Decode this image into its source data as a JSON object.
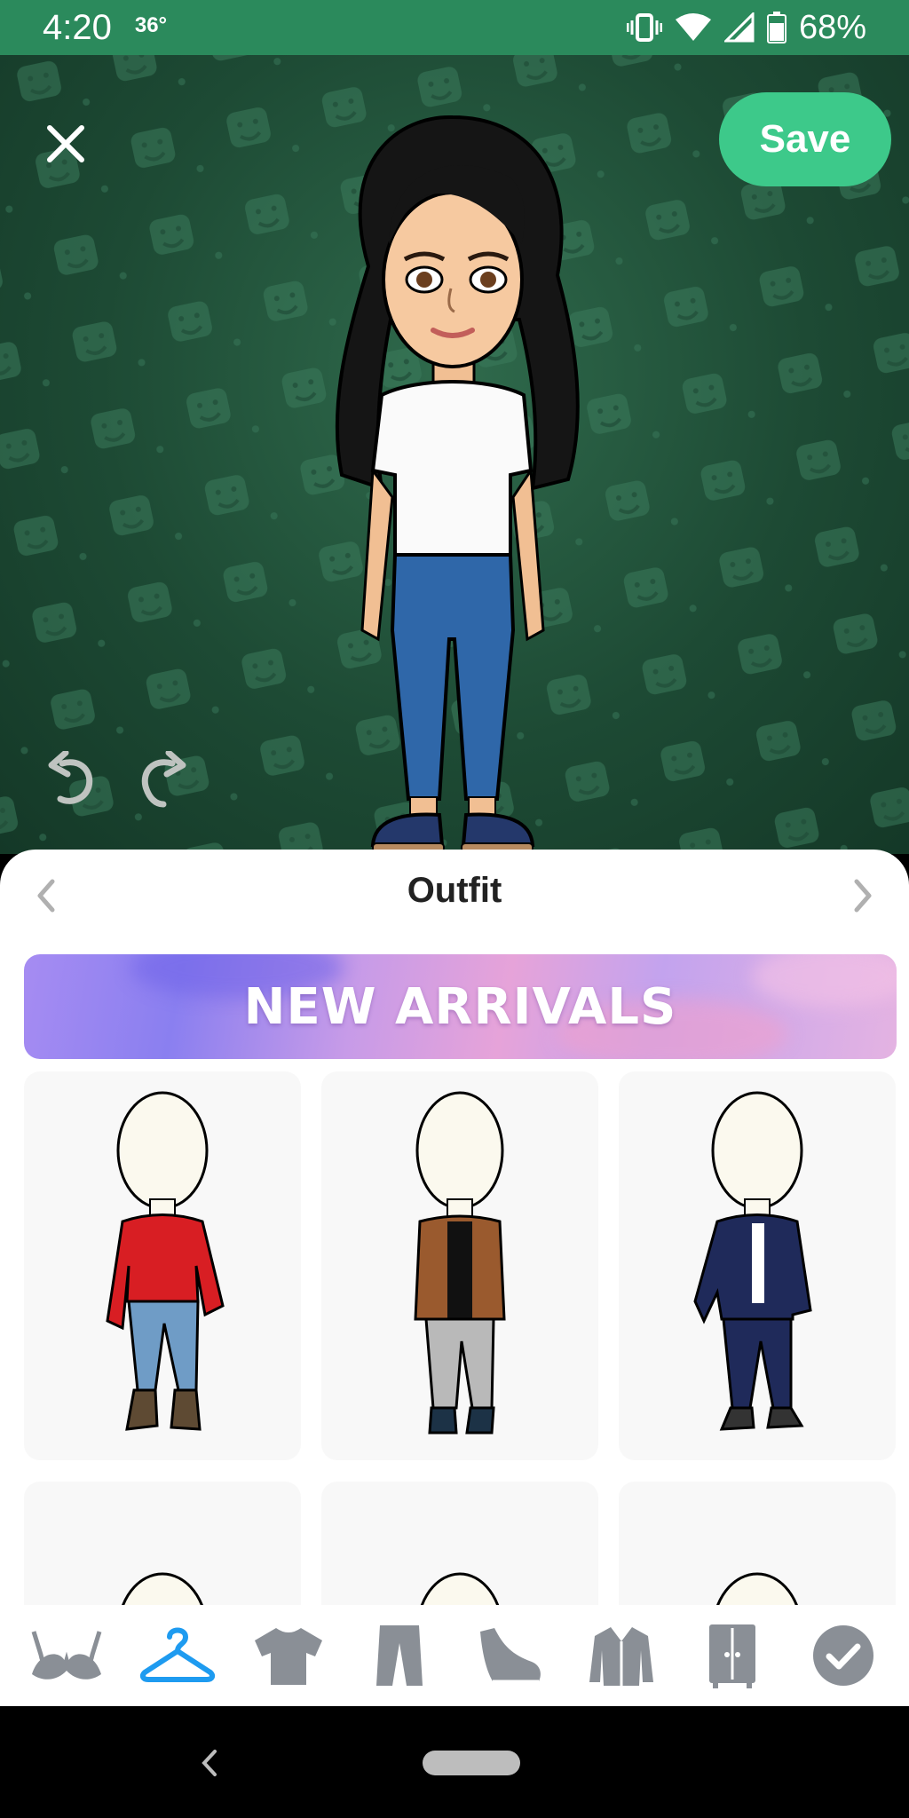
{
  "status_bar": {
    "time": "4:20",
    "temperature": "36°",
    "battery": "68%",
    "icons": [
      "vibrate-icon",
      "wifi-icon",
      "cell-signal-icon",
      "battery-icon"
    ]
  },
  "stage": {
    "close_icon": "close-icon",
    "save_label": "Save",
    "undo_icon": "undo-icon",
    "redo_icon": "redo-icon"
  },
  "sheet": {
    "title": "Outfit",
    "prev_icon": "chevron-left-icon",
    "next_icon": "chevron-right-icon",
    "banner_text": "NEW ARRIVALS"
  },
  "outfits": [
    {
      "name": "red-turtleneck-outfit",
      "top": "#d81e23",
      "bottom": "#6f9cc6",
      "shoes": "#5e4a33"
    },
    {
      "name": "brown-cardigan-outfit",
      "top": "#9a5a2e",
      "bottom": "#b9b9b9",
      "shoes": "#1c3246"
    },
    {
      "name": "denim-jacket-outfit",
      "top": "#1f2a5a",
      "bottom": "#1f2a5a",
      "shoes": "#333333"
    }
  ],
  "tabs": [
    {
      "name": "underwear-tab",
      "icon": "bra-icon",
      "active": false
    },
    {
      "name": "outfit-tab",
      "icon": "hanger-icon",
      "active": true
    },
    {
      "name": "tops-tab",
      "icon": "shirt-icon",
      "active": false
    },
    {
      "name": "bottoms-tab",
      "icon": "pants-icon",
      "active": false
    },
    {
      "name": "shoes-tab",
      "icon": "shoe-icon",
      "active": false
    },
    {
      "name": "outerwear-tab",
      "icon": "jacket-icon",
      "active": false
    },
    {
      "name": "wardrobe-tab",
      "icon": "wardrobe-icon",
      "active": false
    },
    {
      "name": "done-tab",
      "icon": "check-icon",
      "active": false
    }
  ],
  "colors": {
    "status_bg": "#2b8a5c",
    "save_bg": "#3dc98a",
    "active_tab": "#1e9bf0",
    "inactive_tab": "#8a8f96"
  }
}
